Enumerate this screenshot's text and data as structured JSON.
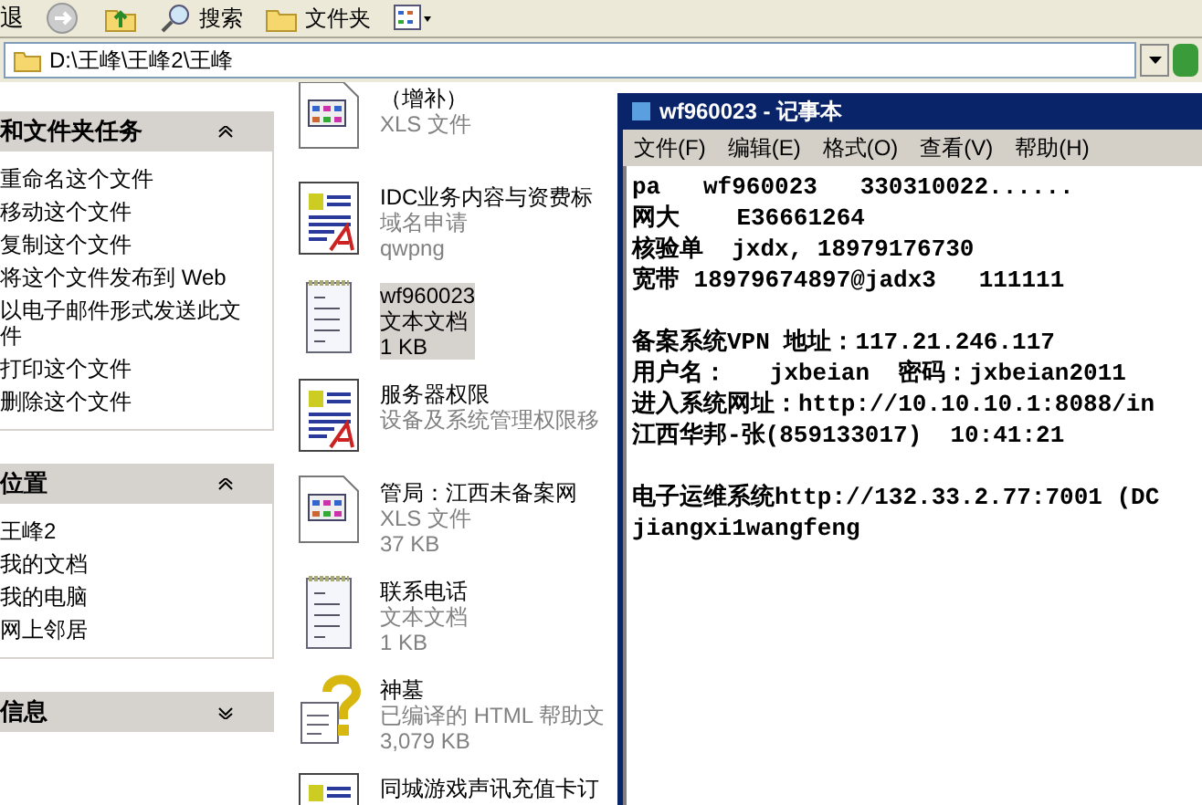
{
  "toolbar": {
    "back_label": "退",
    "buttons": [
      {
        "label": "搜索",
        "kind": "search"
      },
      {
        "label": "文件夹",
        "kind": "folders"
      }
    ]
  },
  "address": {
    "value": "D:\\王峰\\王峰2\\王峰"
  },
  "task_panels": [
    {
      "title": "和文件夹任务",
      "expanded": true,
      "items": [
        "重命名这个文件",
        "移动这个文件",
        "复制这个文件",
        "将这个文件发布到 Web",
        "以电子邮件形式发送此文件",
        "打印这个文件",
        "删除这个文件"
      ]
    },
    {
      "title": "位置",
      "expanded": true,
      "items": [
        "王峰2",
        "我的文档",
        "我的电脑",
        "网上邻居"
      ]
    },
    {
      "title": "信息",
      "expanded": false
    }
  ],
  "files": [
    {
      "kind": "xls",
      "selected": false,
      "lines": [
        "（增补）",
        "XLS 文件"
      ]
    },
    {
      "kind": "doc",
      "selected": false,
      "lines": [
        "IDC业务内容与资费标",
        "域名申请",
        "qwpng"
      ]
    },
    {
      "kind": "txt",
      "selected": true,
      "lines": [
        "wf960023",
        "文本文档",
        "1 KB"
      ]
    },
    {
      "kind": "doc",
      "selected": false,
      "lines": [
        "服务器权限",
        "设备及系统管理权限移"
      ]
    },
    {
      "kind": "xls",
      "selected": false,
      "lines": [
        "管局：江西未备案网",
        "XLS 文件",
        "37 KB"
      ]
    },
    {
      "kind": "txt",
      "selected": false,
      "lines": [
        "联系电话",
        "文本文档",
        "1 KB"
      ]
    },
    {
      "kind": "chm",
      "selected": false,
      "lines": [
        "神墓",
        "已编译的 HTML 帮助文",
        "3,079 KB"
      ]
    },
    {
      "kind": "doc",
      "selected": false,
      "lines": [
        "同城游戏声讯充值卡订"
      ]
    }
  ],
  "notepad": {
    "title": "wf960023 - 记事本",
    "menu": [
      "文件(F)",
      "编辑(E)",
      "格式(O)",
      "查看(V)",
      "帮助(H)"
    ],
    "paragraphs": [
      [
        "pa   wf960023   330310022......",
        "网大    E36661264",
        "核验单  jxdx, 18979176730",
        "宽带 18979674897@jadx3   111111"
      ],
      [
        "备案系统VPN 地址：117.21.246.117",
        "用户名：   jxbeian  密码：jxbeian2011",
        "进入系统网址：http://10.10.10.1:8088/in",
        "江西华邦-张(859133017)  10:41:21"
      ],
      [
        "电子运维系统http://132.33.2.77:7001 (DC",
        "jiangxi1wangfeng"
      ]
    ]
  }
}
